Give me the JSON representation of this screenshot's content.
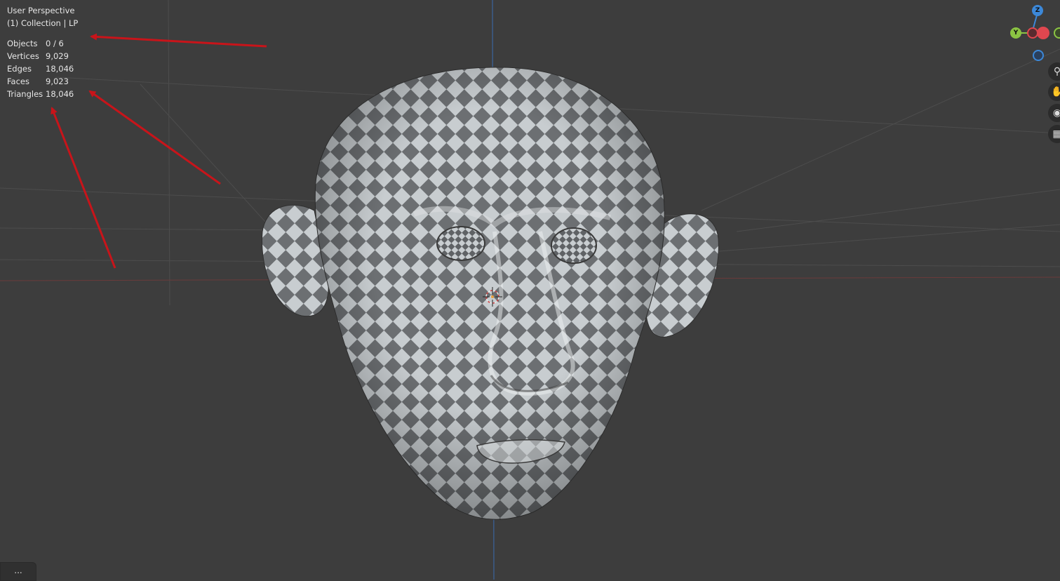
{
  "viewport": {
    "view_name": "User Perspective",
    "collection_label": "(1) Collection | LP",
    "stats": [
      {
        "label": "Objects",
        "value": "0 / 6"
      },
      {
        "label": "Vertices",
        "value": "9,029"
      },
      {
        "label": "Edges",
        "value": "18,046"
      },
      {
        "label": "Faces",
        "value": "9,023"
      },
      {
        "label": "Triangles",
        "value": "18,046"
      }
    ]
  },
  "gizmo": {
    "z_label": "Z",
    "y_label": "Y",
    "x_color": "#e0474f",
    "y_color": "#8bc443",
    "z_color": "#3c88d8"
  },
  "nav_icons": [
    "zoom-icon",
    "hand-icon",
    "camera-icon",
    "grid-icon"
  ],
  "menu": {
    "dots": "..."
  },
  "colors": {
    "background": "#3d3d3d",
    "checker_light": "#c8cdd0",
    "checker_dark": "#6c6f72",
    "annotation_arrow": "#c8141a"
  }
}
